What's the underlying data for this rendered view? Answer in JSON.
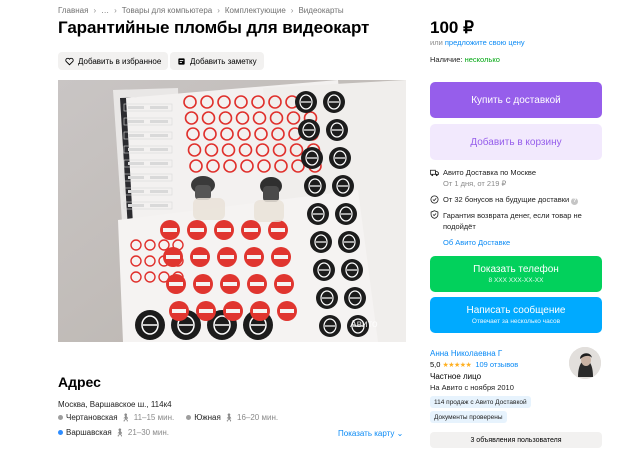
{
  "breadcrumbs": [
    "Главная",
    "…",
    "Товары для компьютера",
    "Комплектующие",
    "Видеокарты"
  ],
  "listing": {
    "title": "Гарантийные пломбы для видеокарт",
    "favorite_label": "Добавить в избранное",
    "note_label": "Добавить заметку",
    "watermark": "Авито"
  },
  "address": {
    "heading": "Адрес",
    "text": "Москва, Варшавское ш., 114к4",
    "metro": [
      {
        "name": "Чертановская",
        "time": "11–15 мин.",
        "color": "#9e9e9e"
      },
      {
        "name": "Южная",
        "time": "16–20 мин.",
        "color": "#9e9e9e"
      },
      {
        "name": "Варшавская",
        "time": "21–30 мин.",
        "color": "#2d8cff"
      }
    ],
    "show_map": "Показать карту"
  },
  "price": {
    "value": "100 ₽",
    "or": "или",
    "suggest": "предложите свою цену",
    "availability_label": "Наличие:",
    "availability_value": "несколько"
  },
  "buttons": {
    "buy": "Купить с доставкой",
    "cart": "Добавить в корзину",
    "phone": "Показать телефон",
    "phone_sub": "8 XXX XXX-XX-XX",
    "message": "Написать сообщение",
    "message_sub": "Отвечает за несколько часов"
  },
  "delivery": {
    "title": "Авито Доставка по Москве",
    "sub": "От 1 дня, от 219 ₽",
    "bonus": "От 32 бонусов на будущие доставки",
    "guarantee": "Гарантия возврата денег, если товар не подойдёт",
    "about": "Об Авито Доставке"
  },
  "seller": {
    "name": "Анна Николаевна Г",
    "rating": "5,0",
    "stars": "★★★★★",
    "reviews": "109 отзывов",
    "type": "Частное лицо",
    "since": "На Авито с ноября 2010",
    "badge_sales": "114 продаж с Авито Доставкой",
    "badge_docs": "Документы проверены",
    "ads_button": "3 объявления пользователя"
  },
  "colors": {
    "purple": "#965eeb",
    "purple_light": "#f2e9fd",
    "green": "#02d15c",
    "blue": "#00aaff",
    "link": "#0a8af5"
  }
}
